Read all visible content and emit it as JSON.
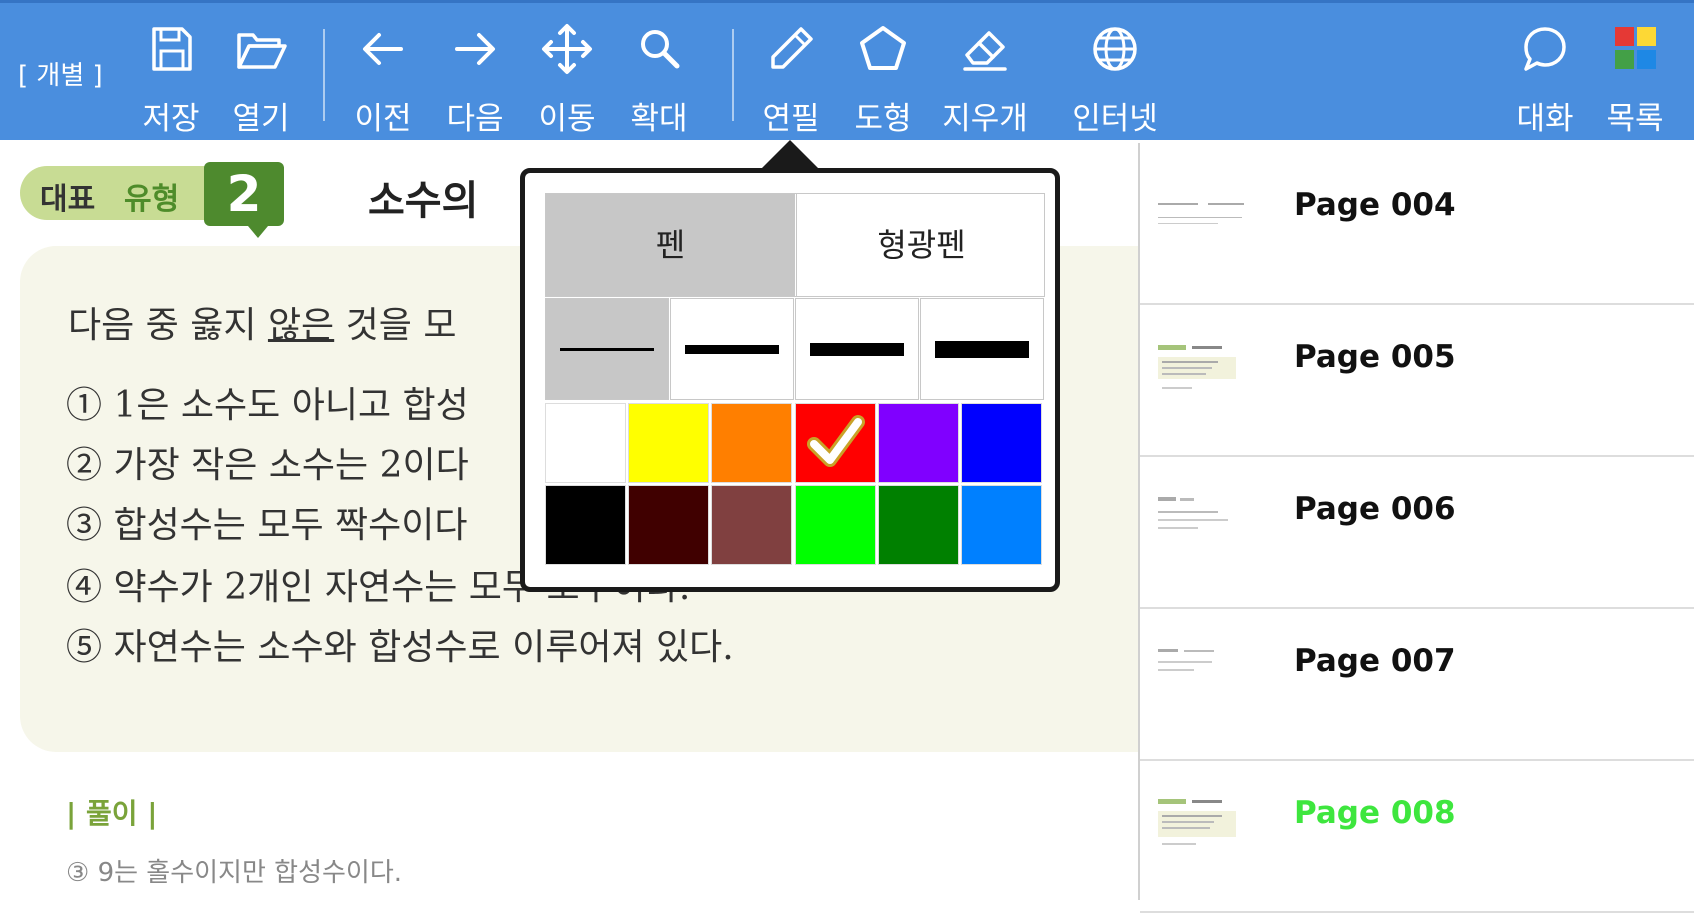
{
  "toolbar": {
    "mode_label": "[ 개별 ]",
    "buttons": {
      "save": "저장",
      "open": "열기",
      "prev": "이전",
      "next": "다음",
      "move": "이동",
      "zoom": "확대",
      "pen": "연필",
      "shape": "도형",
      "eraser": "지우개",
      "internet": "인터넷",
      "chat": "대화",
      "list": "목록"
    }
  },
  "document": {
    "badge_text1": "대표",
    "badge_text2": "유형",
    "badge_number": "2",
    "title": "소수의",
    "question_part1": "다음 중 옳지 ",
    "question_underlined": "않은",
    "question_part2": " 것을 모",
    "choices": [
      "① 1은 소수도 아니고 합성",
      "② 가장 작은 소수는 2이다",
      "③ 합성수는 모두 짝수이다",
      "④ 약수가 2개인 자연수는 모두 소수이다.",
      "⑤ 자연수는 소수와 합성수로 이루어져 있다."
    ],
    "solution_label": "| 풀이 |",
    "solution_text": "③ 9는 홀수이지만 합성수이다."
  },
  "pen_popup": {
    "tabs": [
      "펜",
      "형광펜"
    ],
    "active_tab": 0,
    "thickness_selected": 0,
    "selected_color": 3,
    "colors": [
      "#ffffff",
      "#ffff00",
      "#ff7f00",
      "#ff0000",
      "#8000ff",
      "#0000ff",
      "#000000",
      "#400000",
      "#804040",
      "#00ff00",
      "#008000",
      "#0080ff"
    ]
  },
  "pages": {
    "items": [
      {
        "name": "Page 004",
        "current": false
      },
      {
        "name": "Page 005",
        "current": false
      },
      {
        "name": "Page 006",
        "current": false
      },
      {
        "name": "Page 007",
        "current": false
      },
      {
        "name": "Page 008",
        "current": true
      }
    ],
    "current_color": "#3ee63e"
  }
}
